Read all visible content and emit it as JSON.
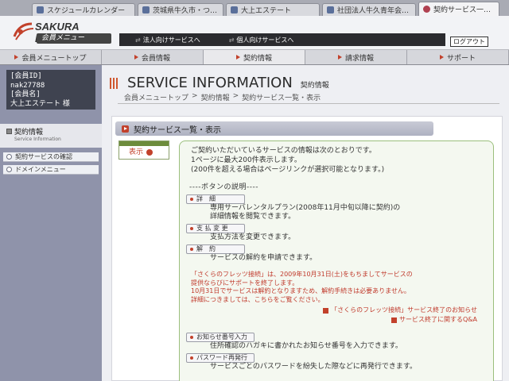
{
  "tabs": [
    {
      "label": "スケジュールカレンダー"
    },
    {
      "label": "茨城県牛久市・つくば市・..."
    },
    {
      "label": "大上エステート"
    },
    {
      "label": "社団法人牛久青年会議..."
    },
    {
      "label": "契約サービス一覧・表..."
    }
  ],
  "header": {
    "brand": "SAKURA Internet",
    "brand_sub": "会員メニュー",
    "link_corporate": "法人向けサービスへ",
    "link_personal": "個人向けサービスへ",
    "logout": "ログアウト"
  },
  "nav": {
    "items": [
      {
        "label": "会員メニュートップ"
      },
      {
        "label": "会員情報"
      },
      {
        "label": "契約情報"
      },
      {
        "label": "請求情報"
      },
      {
        "label": "サポート"
      }
    ]
  },
  "user": {
    "id_label": "[会員ID]",
    "id_value": "nak27788",
    "name_label": "[会員名]",
    "name_value": "大上エステート 様"
  },
  "sidebar": {
    "section_title": "契約情報",
    "section_en": "Service Information",
    "items": [
      {
        "label": "契約サービスの確認"
      },
      {
        "label": "ドメインメニュー"
      }
    ]
  },
  "page": {
    "title": "SERVICE INFORMATION",
    "title_ja": "契約情報",
    "breadcrumb": [
      "会員メニュートップ",
      ">",
      "契約情報",
      ">",
      "契約サービス一覧・表示"
    ],
    "section_title": "契約サービス一覧・表示",
    "show_button": "表示"
  },
  "info": {
    "intro": [
      "ご契約いただいているサービスの情報は次のとおりです。",
      "1ページに最大200件表示します。",
      "(200件を超える場合はページリンクが選択可能となります。)"
    ],
    "legend_title": "----ボタンの説明----",
    "buttons": [
      {
        "label": "詳　細",
        "desc": [
          "専用サーバレンタルプラン(2008年11月中旬以降に契約)の",
          "詳細情報を閲覧できます。"
        ]
      },
      {
        "label": "支 払 変 更",
        "desc": [
          "支払方法を変更できます。"
        ]
      },
      {
        "label": "解　約",
        "desc": [
          "サービスの解約を申請できます。"
        ]
      }
    ],
    "notice": [
      "「さくらのフレッツ接続」は、2009年10月31日(土)をもちましてサービスの",
      "提供ならびにサポートを終了します。",
      "10月31日でサービスは解約となりますため、解約手続きは必要ありません。",
      "詳細につきましては、こちらをご覧ください。"
    ],
    "notice_links": [
      "「さくらのフレッツ接続」サービス終了のお知らせ",
      "サービス終了に関するQ&A"
    ],
    "bottom_buttons": [
      {
        "label": "お知らせ番号入力",
        "desc": "住所確認のハガキに書かれたお知らせ番号を入力できます。"
      },
      {
        "label": "パスワード再発行",
        "desc": "サービスごとのパスワードを紛失した際などに再発行できます。"
      }
    ]
  }
}
